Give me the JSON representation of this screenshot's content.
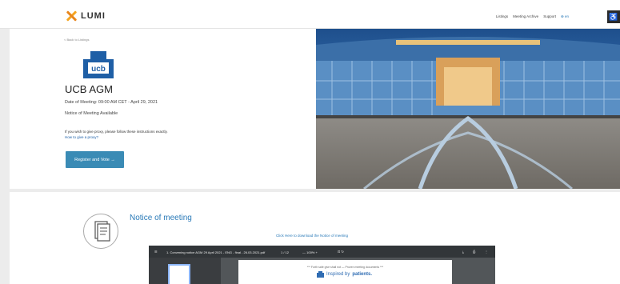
{
  "header": {
    "brand": "LUMI",
    "nav": [
      "Listings",
      "Meeting Archive",
      "Support"
    ],
    "language": "en"
  },
  "meeting": {
    "breadcrumb": "< Back to Listings",
    "logo_text": "ucb",
    "company": "UCB AGM",
    "date": "Date of Meeting: 09:00 AM CET - April 29, 2021",
    "notice_available": "Notice of Meeting Available",
    "proxy_text": "If you wish to give proxy, please follow these instructions exactly.",
    "proxy_link": "How to give a proxy?",
    "register_button": "Register and Vote  →"
  },
  "notice": {
    "title": "Notice of meeting",
    "download_link": "Click Here to download the Notice of meeting"
  },
  "pdf_viewer": {
    "file_name": "1. Convening notice AGM 29 April 2021 - ENG - final - 26.03.2021.pdf",
    "page_display": "1 / 12",
    "zoom": "100%",
    "page_line": "*** Forth safe give shall not — Proven meeting documents ***",
    "brand_prefix": "Inspired by",
    "brand_name": "patients."
  },
  "colors": {
    "accent": "#3a8bb5",
    "link": "#2a7ab8"
  }
}
